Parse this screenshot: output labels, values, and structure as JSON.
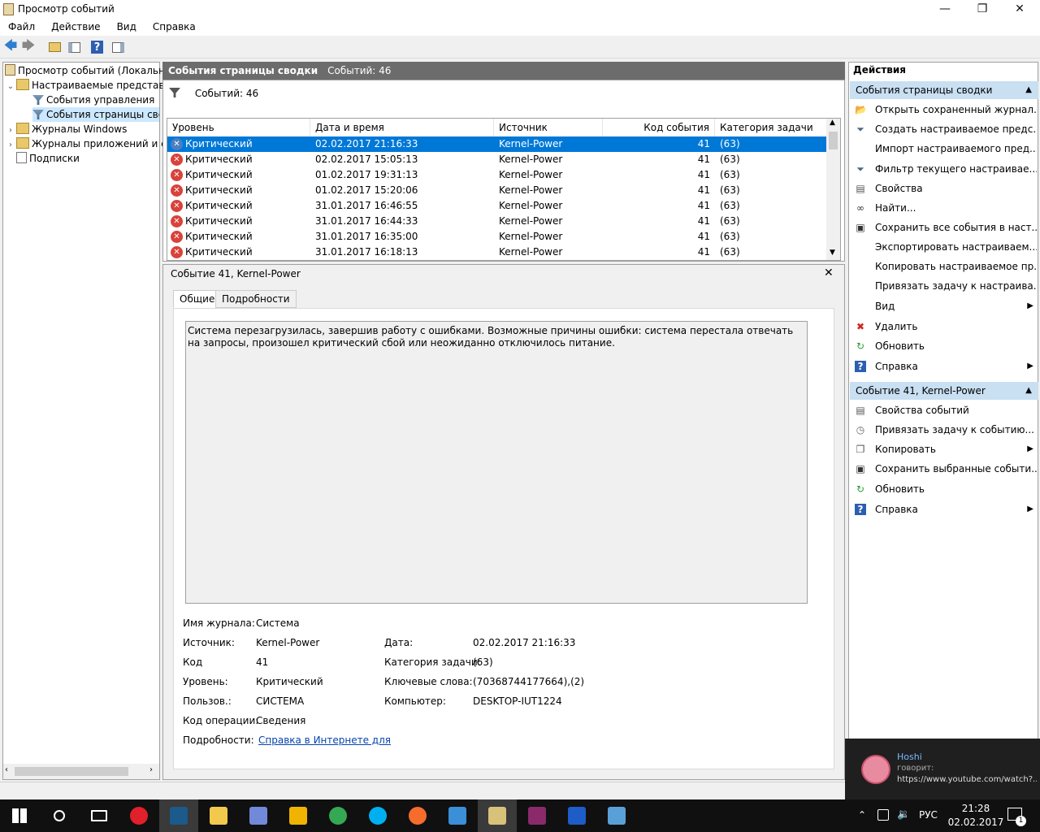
{
  "window": {
    "title": "Просмотр событий",
    "min_glyph": "—",
    "max_glyph": "❐",
    "close_glyph": "✕"
  },
  "menu": [
    "Файл",
    "Действие",
    "Вид",
    "Справка"
  ],
  "toolbar": {
    "icons": [
      "back-arrow-icon",
      "forward-arrow-icon",
      "folder-up-icon",
      "show-hide-tree-icon",
      "help-icon",
      "show-hide-action-pane-icon"
    ],
    "back": "🡄",
    "fwd": "🡆",
    "help": "?"
  },
  "tree": [
    {
      "label": "Просмотр событий (Локальны",
      "indent": 0,
      "exp": ""
    },
    {
      "label": "Настраиваемые представле",
      "indent": 1,
      "exp": "⌄"
    },
    {
      "label": "События управления",
      "indent": 2,
      "exp": ""
    },
    {
      "label": "События страницы свод",
      "indent": 2,
      "exp": "",
      "selected": true
    },
    {
      "label": "Журналы Windows",
      "indent": 1,
      "exp": "›"
    },
    {
      "label": "Журналы приложений и сл",
      "indent": 1,
      "exp": "›"
    },
    {
      "label": "Подписки",
      "indent": 1,
      "exp": ""
    }
  ],
  "summary": {
    "title": "События страницы сводки",
    "count_label": "Событий: 46",
    "filter_label": "Событий: 46"
  },
  "grid": {
    "columns": [
      "Уровень",
      "Дата и время",
      "Источник",
      "Код события",
      "Категория задачи"
    ],
    "rows": [
      [
        "Критический",
        "02.02.2017 21:16:33",
        "Kernel-Power",
        "41",
        "(63)"
      ],
      [
        "Критический",
        "02.02.2017 15:05:13",
        "Kernel-Power",
        "41",
        "(63)"
      ],
      [
        "Критический",
        "01.02.2017 19:31:13",
        "Kernel-Power",
        "41",
        "(63)"
      ],
      [
        "Критический",
        "01.02.2017 15:20:06",
        "Kernel-Power",
        "41",
        "(63)"
      ],
      [
        "Критический",
        "31.01.2017 16:46:55",
        "Kernel-Power",
        "41",
        "(63)"
      ],
      [
        "Критический",
        "31.01.2017 16:44:33",
        "Kernel-Power",
        "41",
        "(63)"
      ],
      [
        "Критический",
        "31.01.2017 16:35:00",
        "Kernel-Power",
        "41",
        "(63)"
      ],
      [
        "Критический",
        "31.01.2017 16:18:13",
        "Kernel-Power",
        "41",
        "(63)"
      ]
    ],
    "error_glyph": "✕"
  },
  "detail": {
    "title": "Событие 41, Kernel-Power",
    "close_glyph": "✕",
    "tabs": [
      "Общие",
      "Подробности"
    ],
    "description": "Система перезагрузилась, завершив работу с ошибками. Возможные причины ошибки: система перестала отвечать на запросы, произошел критический сбой или неожиданно отключилось питание.",
    "fields": {
      "log_name_label": "Имя журнала:",
      "log_name": "Система",
      "source_label": "Источник:",
      "source": "Kernel-Power",
      "date_label": "Дата:",
      "date": "02.02.2017 21:16:33",
      "code_label": "Код",
      "code": "41",
      "task_label": "Категория задачи:",
      "task": "(63)",
      "level_label": "Уровень:",
      "level": "Критический",
      "keywords_label": "Ключевые слова:",
      "keywords": "(70368744177664),(2)",
      "user_label": "Пользов.:",
      "user": "СИСТЕМА",
      "computer_label": "Компьютер:",
      "computer": "DESKTOP-IUT1224",
      "opcode_label": "Код операции:",
      "opcode": "Сведения",
      "details_label": "Подробности:",
      "details_link": "Справка в Интернете для"
    }
  },
  "actions": {
    "header": "Действия",
    "section1": "События страницы сводки",
    "section1_items": [
      {
        "label": "Открыть сохраненный журнал...",
        "icon": "open-log-icon",
        "glyph": "📂",
        "arrow": ""
      },
      {
        "label": "Создать настраиваемое предс...",
        "icon": "filter-icon",
        "glyph": "⏷",
        "arrow": ""
      },
      {
        "label": "Импорт настраиваемого пред...",
        "icon": "",
        "glyph": "",
        "arrow": ""
      },
      {
        "label": "Фильтр текущего настраивае...",
        "icon": "filter-icon",
        "glyph": "⏷",
        "arrow": ""
      },
      {
        "label": "Свойства",
        "icon": "properties-icon",
        "glyph": "▤",
        "arrow": ""
      },
      {
        "label": "Найти...",
        "icon": "find-icon",
        "glyph": "∞",
        "arrow": ""
      },
      {
        "label": "Сохранить все события в наст...",
        "icon": "save-icon",
        "glyph": "▣",
        "arrow": ""
      },
      {
        "label": "Экспортировать настраиваем...",
        "icon": "",
        "glyph": "",
        "arrow": ""
      },
      {
        "label": "Копировать настраиваемое пр...",
        "icon": "",
        "glyph": "",
        "arrow": ""
      },
      {
        "label": "Привязать задачу к настраива...",
        "icon": "",
        "glyph": "",
        "arrow": ""
      },
      {
        "label": "Вид",
        "icon": "",
        "glyph": "",
        "arrow": "▶"
      },
      {
        "label": "Удалить",
        "icon": "delete-icon",
        "glyph": "✖",
        "arrow": ""
      },
      {
        "label": "Обновить",
        "icon": "refresh-icon",
        "glyph": "↻",
        "arrow": ""
      },
      {
        "label": "Справка",
        "icon": "help-icon",
        "glyph": "?",
        "arrow": "▶"
      }
    ],
    "section2": "Событие 41, Kernel-Power",
    "section2_items": [
      {
        "label": "Свойства событий",
        "icon": "properties-icon",
        "glyph": "▤",
        "arrow": ""
      },
      {
        "label": "Привязать задачу к событию...",
        "icon": "task-icon",
        "glyph": "◷",
        "arrow": ""
      },
      {
        "label": "Копировать",
        "icon": "copy-icon",
        "glyph": "❐",
        "arrow": "▶"
      },
      {
        "label": "Сохранить выбранные событи...",
        "icon": "save-icon",
        "glyph": "▣",
        "arrow": ""
      },
      {
        "label": "Обновить",
        "icon": "refresh-icon",
        "glyph": "↻",
        "arrow": ""
      },
      {
        "label": "Справка",
        "icon": "help-icon",
        "glyph": "?",
        "arrow": "▶"
      }
    ],
    "collapse_glyph": "▲"
  },
  "notification": {
    "name": "Hoshi",
    "says": "говорит:",
    "text": "https://www.youtube.com/watch?..."
  },
  "taskbar": {
    "apps": [
      {
        "name": "start-icon",
        "color": "#ffffff"
      },
      {
        "name": "search-icon",
        "color": "#ffffff"
      },
      {
        "name": "task-view-icon",
        "color": "#ffffff"
      },
      {
        "name": "opera-icon",
        "color": "#e0202a"
      },
      {
        "name": "steam-icon",
        "color": "#1b5a8a"
      },
      {
        "name": "file-explorer-icon",
        "color": "#f2c94c"
      },
      {
        "name": "discord-icon",
        "color": "#7289da"
      },
      {
        "name": "app-icon",
        "color": "#f0b400"
      },
      {
        "name": "chrome-icon",
        "color": "#34a853"
      },
      {
        "name": "skype-icon",
        "color": "#00aff0"
      },
      {
        "name": "origin-icon",
        "color": "#f56c2d"
      },
      {
        "name": "app-window-icon",
        "color": "#3a8fd6"
      },
      {
        "name": "event-viewer-icon",
        "color": "#d8c27a"
      },
      {
        "name": "winrar-icon",
        "color": "#8b2a6a"
      },
      {
        "name": "monitor-icon",
        "color": "#1e5cc7"
      },
      {
        "name": "paint-icon",
        "color": "#5aa0d8"
      }
    ],
    "tray": {
      "lang": "РУС",
      "time": "21:28",
      "date": "02.02.2017",
      "chevron": "⌃",
      "notif_count": "1"
    }
  }
}
